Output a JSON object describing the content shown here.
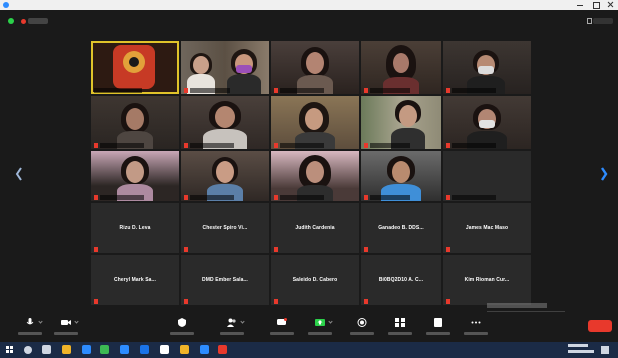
{
  "meeting": {
    "name_only_tiles": [
      {
        "label": "Rizu D. Leva"
      },
      {
        "label": "Chester Spiro Vi..."
      },
      {
        "label": "Judith Cardenia"
      },
      {
        "label": "Ganadeo B. DDS..."
      },
      {
        "label": "James Mac Maso"
      },
      {
        "label": "Cheryl Mark Sa..."
      },
      {
        "label": "DMD Ember Sala..."
      },
      {
        "label": "Saleido D. Cabero"
      },
      {
        "label": "Bi0BQ2D10 A. C..."
      },
      {
        "label": "Kim Rioman Cur..."
      }
    ]
  },
  "colors": {
    "accent_blue": "#2d8cff",
    "end_red": "#e8392c",
    "active_speaker": "#e0c32a",
    "background": "#1a1a1a",
    "taskbar": "#1b2b46"
  },
  "icons": {
    "window": "zoom-app-icon",
    "security": "shield-icon",
    "recording": "recording-dot-icon",
    "view": "grid-view-icon",
    "prev_page": "chevron-left-icon",
    "next_page": "chevron-right-icon",
    "mute": "microphone-icon",
    "video": "video-camera-icon",
    "security_tool": "shield-icon",
    "participants": "participants-icon",
    "chat": "chat-bubble-icon",
    "share": "share-screen-icon",
    "record": "record-icon",
    "breakout": "breakout-rooms-icon",
    "reactions": "reactions-icon",
    "more": "more-icon",
    "start": "windows-start-icon"
  }
}
